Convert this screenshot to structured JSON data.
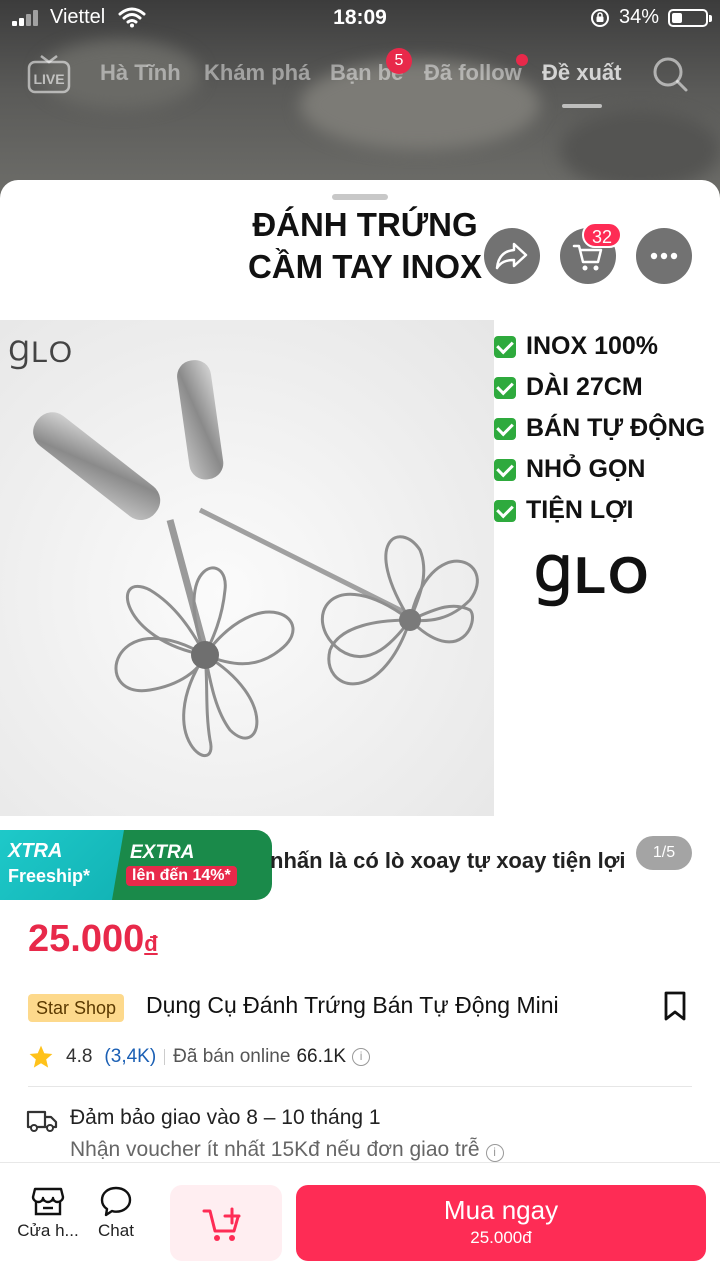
{
  "status_bar": {
    "carrier": "Viettel",
    "time": "18:09",
    "battery": "34%"
  },
  "top_nav": {
    "tabs": [
      {
        "label": "Hà Tĩnh"
      },
      {
        "label": "Khám phá"
      },
      {
        "label": "Bạn bè",
        "badge": "5"
      },
      {
        "label": "Đã follow"
      },
      {
        "label": "Đề xuất",
        "active": true
      }
    ],
    "live_label": "LIVE"
  },
  "header": {
    "title_line1": "ĐÁNH TRỨNG",
    "title_line2": "CẦM TAY INOX",
    "cart_count": "32"
  },
  "product_image": {
    "logo_small": "ꞬLO",
    "logo_big": "ꞬLO",
    "features": [
      "INOX 100%",
      "DÀI 27CM",
      "BÁN TỰ ĐỘNG",
      "NHỎ GỌN",
      "TIỆN LỢI"
    ],
    "counter": "1/5"
  },
  "promo": {
    "xtra_title": "XTRA",
    "xtra_sub": "Freeship*",
    "extra_title": "EXTRA",
    "extra_sub": "lên đến 14%*",
    "caption": "nhấn là có lò xoay tự xoay tiện lợi"
  },
  "product": {
    "price": "25.000",
    "currency": "đ",
    "shop_badge": "Star Shop",
    "title": "Dụng Cụ Đánh Trứng Bán Tự Động Mini",
    "rating": "4.8",
    "rating_count": "(3,4K)",
    "sold_label": "Đã bán online",
    "sold_value": "66.1K"
  },
  "shipping": {
    "line1": "Đảm bảo giao vào 8 – 10 tháng 1",
    "line2": "Nhận voucher ít nhất 15Kđ nếu đơn giao trễ"
  },
  "bottom_bar": {
    "shop_label": "Cửa h...",
    "chat_label": "Chat",
    "buy_label": "Mua ngay",
    "buy_price": "25.000đ"
  },
  "colors": {
    "accent": "#fe2c55",
    "price": "#e8294a",
    "check": "#2eaa3d"
  }
}
